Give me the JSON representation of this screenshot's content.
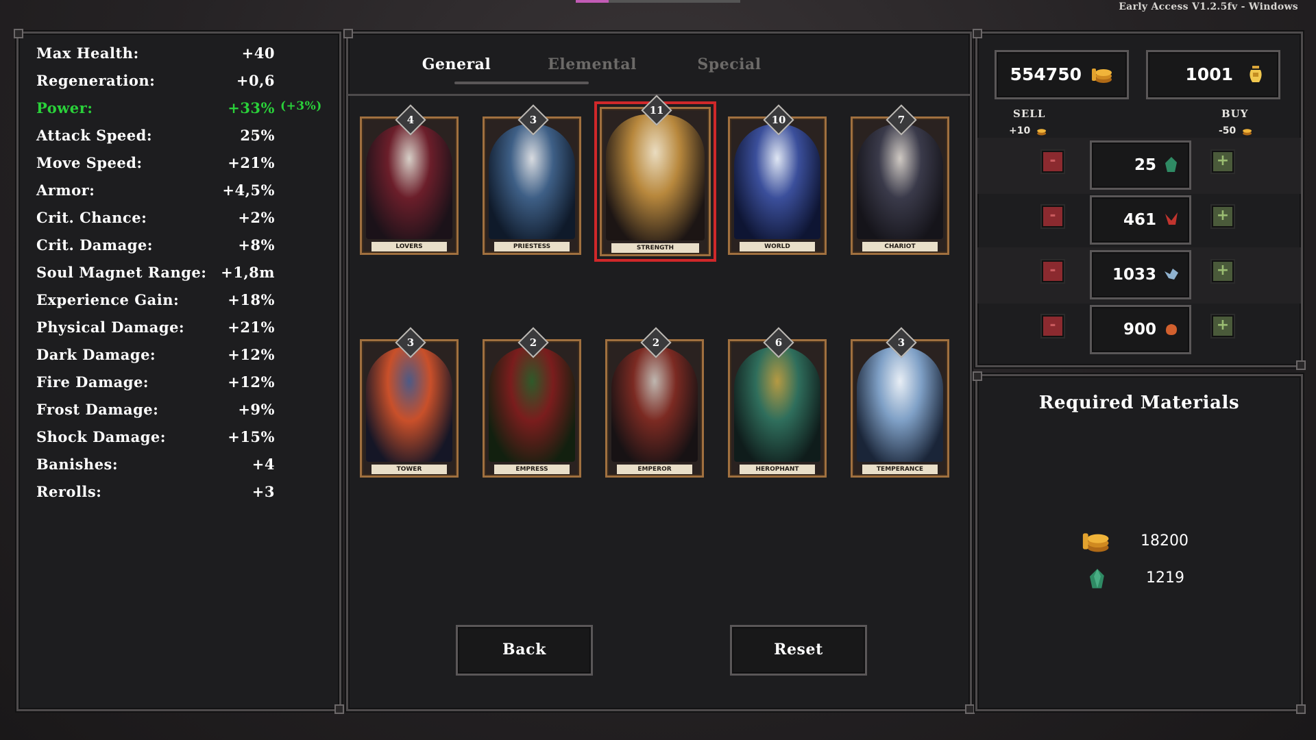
{
  "app": {
    "version_text": "Early Access V1.2.5fv - Windows"
  },
  "stats": [
    {
      "label": "Max Health:",
      "value": "+40",
      "color": "#ffffff"
    },
    {
      "label": "Regeneration:",
      "value": "+0,6",
      "color": "#ffffff"
    },
    {
      "label": "Power:",
      "value": "+33%",
      "extra": "(+3%)",
      "color": "#2ad13a"
    },
    {
      "label": "Attack Speed:",
      "value": "25%",
      "color": "#ffffff"
    },
    {
      "label": "Move Speed:",
      "value": "+21%",
      "color": "#ffffff"
    },
    {
      "label": "Armor:",
      "value": "+4,5%",
      "color": "#ffffff"
    },
    {
      "label": "Crit. Chance:",
      "value": "+2%",
      "color": "#ffffff"
    },
    {
      "label": "Crit. Damage:",
      "value": "+8%",
      "color": "#ffffff"
    },
    {
      "label": "Soul Magnet Range:",
      "value": "+1,8m",
      "color": "#ffffff"
    },
    {
      "label": "Experience Gain:",
      "value": "+18%",
      "color": "#ffffff"
    },
    {
      "label": "Physical Damage:",
      "value": "+21%",
      "color": "#ffffff"
    },
    {
      "label": "Dark Damage:",
      "value": "+12%",
      "color": "#ffffff"
    },
    {
      "label": "Fire Damage:",
      "value": "+12%",
      "color": "#ffffff"
    },
    {
      "label": "Frost Damage:",
      "value": "+9%",
      "color": "#ffffff"
    },
    {
      "label": "Shock Damage:",
      "value": "+15%",
      "color": "#ffffff"
    },
    {
      "label": "Banishes:",
      "value": "+4",
      "color": "#ffffff"
    },
    {
      "label": "Rerolls:",
      "value": "+3",
      "color": "#ffffff"
    }
  ],
  "tabs": [
    {
      "label": "General",
      "active": true
    },
    {
      "label": "Elemental",
      "active": false
    },
    {
      "label": "Special",
      "active": false
    }
  ],
  "cards": [
    {
      "name": "LOVERS",
      "level": "4",
      "selected": false,
      "palette": [
        "#1b1219",
        "#6b1e2a",
        "#d7cfc7"
      ]
    },
    {
      "name": "PRIESTESS",
      "level": "3",
      "selected": false,
      "palette": [
        "#0f1a2a",
        "#3e5f86",
        "#d8dbe0"
      ]
    },
    {
      "name": "STRENGTH",
      "level": "11",
      "selected": true,
      "palette": [
        "#1c1514",
        "#b8883d",
        "#eadcc0"
      ]
    },
    {
      "name": "WORLD",
      "level": "10",
      "selected": false,
      "palette": [
        "#0e1533",
        "#3b4f9b",
        "#dfe6f3"
      ]
    },
    {
      "name": "CHARIOT",
      "level": "7",
      "selected": false,
      "palette": [
        "#15141a",
        "#3a3a4a",
        "#cfc9c3"
      ]
    },
    {
      "name": "TOWER",
      "level": "3",
      "selected": false,
      "palette": [
        "#151626",
        "#c9502a",
        "#4d5a86"
      ]
    },
    {
      "name": "EMPRESS",
      "level": "2",
      "selected": false,
      "palette": [
        "#12200f",
        "#7a1d1d",
        "#2f5a2a"
      ]
    },
    {
      "name": "EMPEROR",
      "level": "2",
      "selected": false,
      "palette": [
        "#171214",
        "#7b2a22",
        "#bfb7b0"
      ]
    },
    {
      "name": "HEROPHANT",
      "level": "6",
      "selected": false,
      "palette": [
        "#0f1c1b",
        "#2f6e5c",
        "#b59a43"
      ]
    },
    {
      "name": "TEMPERANCE",
      "level": "3",
      "selected": false,
      "palette": [
        "#1a2538",
        "#7fa0c6",
        "#e8eef5"
      ]
    }
  ],
  "buttons": {
    "back": "Back",
    "reset": "Reset"
  },
  "shop": {
    "gold": "554750",
    "souls": "1001",
    "sell_label": "SELL",
    "buy_label": "BUY",
    "sell_value": "+10",
    "buy_value": "-50",
    "resources": [
      {
        "amount": "25",
        "icon": "green-crystal-icon",
        "color": "#2f8a64"
      },
      {
        "amount": "461",
        "icon": "red-crystal-icon",
        "color": "#c0342e"
      },
      {
        "amount": "1033",
        "icon": "blue-crystal-icon",
        "color": "#8fb2d0"
      },
      {
        "amount": "900",
        "icon": "orange-ore-icon",
        "color": "#d2602e"
      }
    ],
    "minus": "-",
    "plus": "+"
  },
  "materials": {
    "title": "Required Materials",
    "items": [
      {
        "amount": "18200",
        "icon": "gold-coins-icon"
      },
      {
        "amount": "1219",
        "icon": "green-crystal-icon"
      }
    ]
  }
}
